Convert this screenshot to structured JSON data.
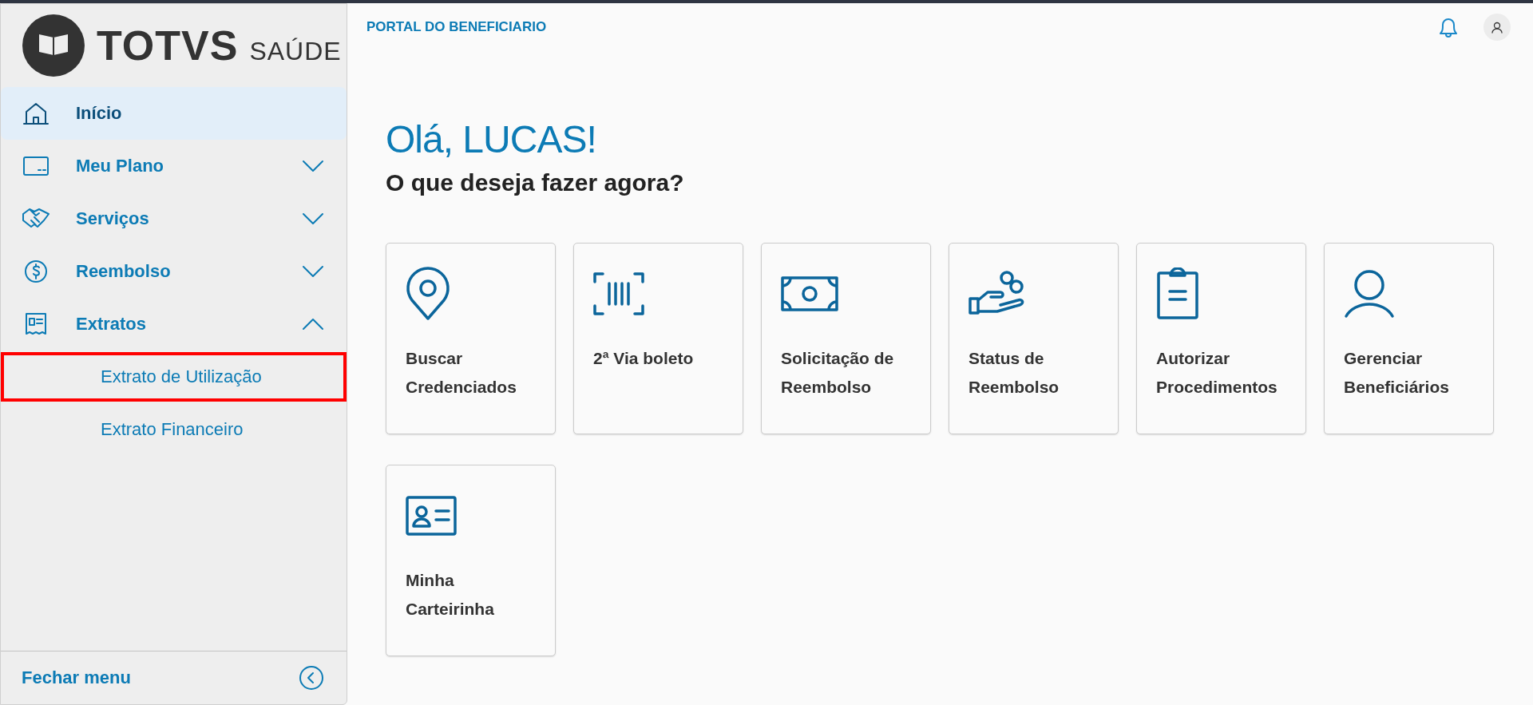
{
  "sidebar": {
    "logo": {
      "brand": "TOTVS",
      "product": "SAÚDE"
    },
    "items": [
      {
        "label": "Início",
        "selected": true
      },
      {
        "label": "Meu Plano",
        "selected": false,
        "expanded": false
      },
      {
        "label": "Serviços",
        "selected": false,
        "expanded": false
      },
      {
        "label": "Reembolso",
        "selected": false,
        "expanded": false
      },
      {
        "label": "Extratos",
        "selected": false,
        "expanded": true,
        "children": [
          {
            "label": "Extrato de Utilização",
            "highlighted": true
          },
          {
            "label": "Extrato Financeiro",
            "highlighted": false
          }
        ]
      }
    ],
    "footer": {
      "label": "Fechar menu"
    }
  },
  "header": {
    "title": "PORTAL DO BENEFICIARIO"
  },
  "greeting": "Olá, LUCAS!",
  "subtitle": "O que deseja fazer agora?",
  "cards": [
    {
      "label": "Buscar Credenciados"
    },
    {
      "label": "2ª Via boleto"
    },
    {
      "label": "Solicitação de Reembolso"
    },
    {
      "label": "Status de Reembolso"
    },
    {
      "label": "Autorizar Procedimentos"
    },
    {
      "label": "Gerenciar Beneficiários"
    },
    {
      "label": "Minha Carteirinha"
    }
  ]
}
